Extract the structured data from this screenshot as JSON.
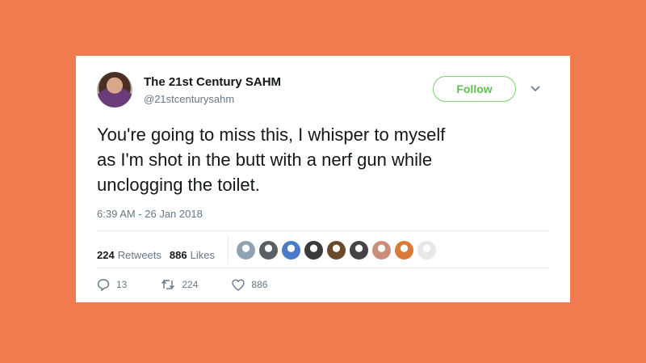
{
  "user": {
    "name": "The 21st Century SAHM",
    "handle": "@21stcenturysahm"
  },
  "follow_label": "Follow",
  "tweet": {
    "lines": [
      "You're going to miss this, I whisper to myself",
      "as I'm shot in the butt with a nerf gun while",
      "unclogging the toilet."
    ],
    "timestamp": "6:39 AM - 26 Jan 2018"
  },
  "stats": {
    "retweets_count": "224",
    "retweets_label": "Retweets",
    "likes_count": "886",
    "likes_label": "Likes"
  },
  "likers": [
    {
      "color": "#8fa3b3"
    },
    {
      "color": "#5a5f66"
    },
    {
      "color": "#4a7bc8"
    },
    {
      "color": "#3a3a3a"
    },
    {
      "color": "#6b4a2a"
    },
    {
      "color": "#444444"
    },
    {
      "color": "#c98f7a"
    },
    {
      "color": "#d97a3a"
    },
    {
      "color": "#e8e8e8"
    }
  ],
  "actions": {
    "reply_count": "13",
    "retweet_count": "224",
    "like_count": "886"
  },
  "colors": {
    "background": "#ef7b4f",
    "follow_green": "#5fbf50",
    "muted": "#657786"
  },
  "icons": [
    "chevron-down-icon",
    "reply-icon",
    "retweet-icon",
    "heart-icon"
  ]
}
